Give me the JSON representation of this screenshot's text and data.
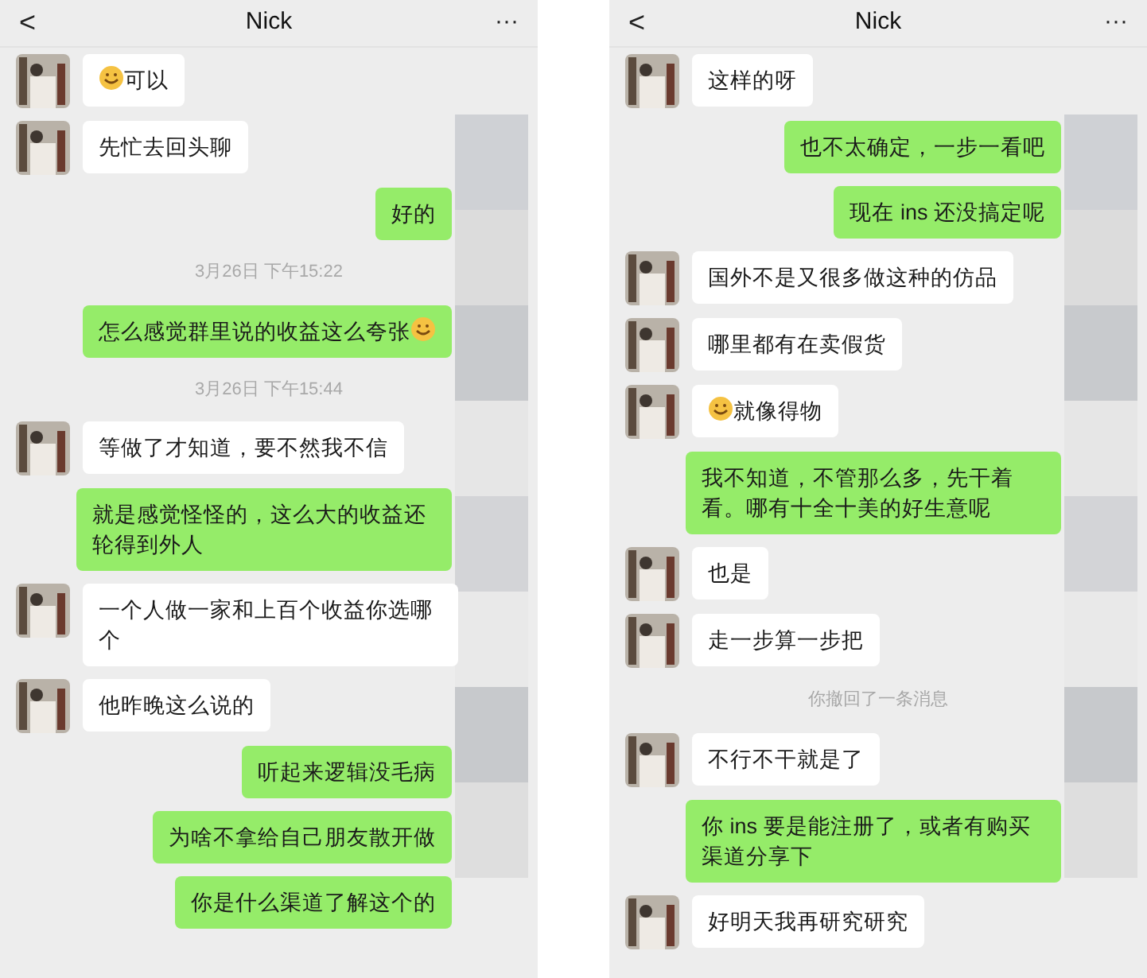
{
  "screens": [
    {
      "header": {
        "back": "<",
        "title": "Nick",
        "more": "···"
      },
      "messages": [
        {
          "kind": "received",
          "text": "可以",
          "emoji_first": true
        },
        {
          "kind": "received",
          "text": "先忙去回头聊"
        },
        {
          "kind": "sent",
          "text": "好的"
        },
        {
          "kind": "time",
          "text": "3月26日 下午15:22"
        },
        {
          "kind": "sent",
          "text": "怎么感觉群里说的收益这么夸张",
          "emoji_last": true
        },
        {
          "kind": "time",
          "text": "3月26日 下午15:44"
        },
        {
          "kind": "received",
          "text": "等做了才知道，要不然我不信"
        },
        {
          "kind": "sent",
          "text": "就是感觉怪怪的，这么大的收益还轮得到外人"
        },
        {
          "kind": "received",
          "text": "一个人做一家和上百个收益你选哪个"
        },
        {
          "kind": "received",
          "text": "他昨晚这么说的"
        },
        {
          "kind": "sent",
          "text": "听起来逻辑没毛病"
        },
        {
          "kind": "sent",
          "text": "为啥不拿给自己朋友散开做"
        },
        {
          "kind": "sent",
          "text": "你是什么渠道了解这个的"
        }
      ]
    },
    {
      "header": {
        "back": "<",
        "title": "Nick",
        "more": "···"
      },
      "messages": [
        {
          "kind": "received",
          "text": "这样的呀"
        },
        {
          "kind": "sent",
          "text": "也不太确定，一步一看吧"
        },
        {
          "kind": "sent",
          "text": "现在 ins 还没搞定呢"
        },
        {
          "kind": "received",
          "text": "国外不是又很多做这种的仿品"
        },
        {
          "kind": "received",
          "text": "哪里都有在卖假货"
        },
        {
          "kind": "received",
          "text": "就像得物",
          "emoji_first": true
        },
        {
          "kind": "sent",
          "text": "我不知道，不管那么多，先干着看。哪有十全十美的好生意呢"
        },
        {
          "kind": "received",
          "text": "也是"
        },
        {
          "kind": "received",
          "text": "走一步算一步把"
        },
        {
          "kind": "notice",
          "text": "你撤回了一条消息"
        },
        {
          "kind": "received",
          "text": "不行不干就是了"
        },
        {
          "kind": "sent",
          "text": "你 ins 要是能注册了，或者有购买渠道分享下"
        },
        {
          "kind": "received",
          "text": "好明天我再研究研究"
        }
      ]
    }
  ]
}
